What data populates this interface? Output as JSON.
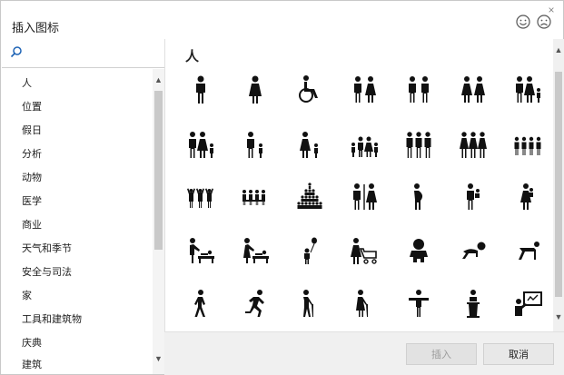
{
  "dialog": {
    "title": "插入图标",
    "close_label": "×"
  },
  "feedback": {
    "smile_icon": "smiley-face-icon",
    "frown_icon": "frowning-face-icon"
  },
  "search": {
    "icon": "search-icon",
    "value": "",
    "placeholder": ""
  },
  "categories": [
    {
      "label": "人"
    },
    {
      "label": "位置"
    },
    {
      "label": "假日"
    },
    {
      "label": "分析"
    },
    {
      "label": "动物"
    },
    {
      "label": "医学"
    },
    {
      "label": "商业"
    },
    {
      "label": "天气和季节"
    },
    {
      "label": "安全与司法"
    },
    {
      "label": "家"
    },
    {
      "label": "工具和建筑物"
    },
    {
      "label": "庆典"
    },
    {
      "label": "建筑"
    }
  ],
  "section": {
    "title": "人"
  },
  "icons": [
    {
      "name": "man-icon"
    },
    {
      "name": "woman-icon"
    },
    {
      "name": "wheelchair-icon"
    },
    {
      "name": "man-and-woman-icon"
    },
    {
      "name": "two-men-icon"
    },
    {
      "name": "two-women-icon"
    },
    {
      "name": "family-with-child-icon"
    },
    {
      "name": "parents-with-child-icon"
    },
    {
      "name": "man-with-child-icon"
    },
    {
      "name": "woman-with-child-icon"
    },
    {
      "name": "family-walking-icon"
    },
    {
      "name": "three-men-icon"
    },
    {
      "name": "three-women-icon"
    },
    {
      "name": "group-of-four-icon"
    },
    {
      "name": "cheering-group-icon"
    },
    {
      "name": "small-group-icon"
    },
    {
      "name": "crowd-pyramid-icon"
    },
    {
      "name": "restroom-sign-icon"
    },
    {
      "name": "pregnant-woman-icon"
    },
    {
      "name": "man-carrying-baby-icon"
    },
    {
      "name": "woman-carrying-baby-icon"
    },
    {
      "name": "man-changing-baby-icon"
    },
    {
      "name": "woman-changing-baby-icon"
    },
    {
      "name": "child-with-balloon-icon"
    },
    {
      "name": "stroller-icon"
    },
    {
      "name": "baby-icon"
    },
    {
      "name": "crawling-baby-icon"
    },
    {
      "name": "crawling-person-icon"
    },
    {
      "name": "walking-person-icon"
    },
    {
      "name": "running-person-icon"
    },
    {
      "name": "elderly-man-with-cane-icon"
    },
    {
      "name": "elderly-woman-with-cane-icon"
    },
    {
      "name": "person-arms-out-icon"
    },
    {
      "name": "speaker-at-podium-icon"
    },
    {
      "name": "presenter-at-board-icon"
    }
  ],
  "footer": {
    "insert_label": "插入",
    "cancel_label": "取消"
  }
}
